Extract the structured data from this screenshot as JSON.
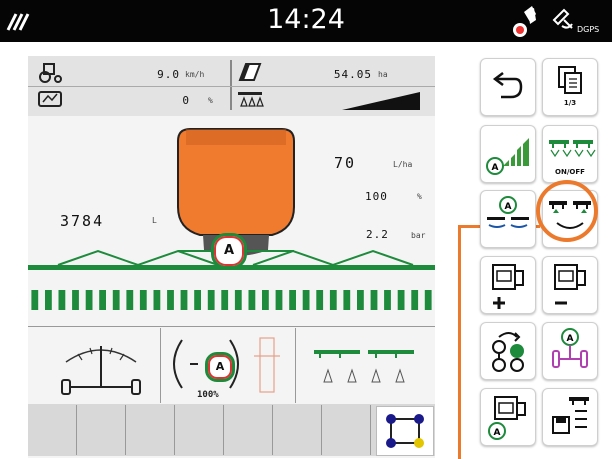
{
  "status_bar": {
    "time": "14:24",
    "gps_mode": "DGPS"
  },
  "info": {
    "speed_value": "9.0",
    "speed_unit": "km/h",
    "area_value": "54.05",
    "area_unit": "ha",
    "pct_value": "0",
    "pct_unit": "%"
  },
  "sprayer": {
    "rate_value": "70",
    "rate_unit": "L/ha",
    "rate_pct_value": "100",
    "rate_pct_unit": "%",
    "tank_value": "3784",
    "tank_unit": "L",
    "pressure_value": "2.2",
    "pressure_unit": "bar",
    "tank_badge": "A",
    "nozzle_sections_open": 30
  },
  "lower": {
    "center_gauge_label": "100%",
    "center_badge": "A"
  },
  "buttons": {
    "onoff_label": "ON/OFF",
    "page_label": "1/3"
  },
  "colors": {
    "accent": "#e8782a",
    "tank_orange": "#f07a2e",
    "boom_green": "#1e8a3c",
    "highlight_circle": "#ec7a2d"
  }
}
